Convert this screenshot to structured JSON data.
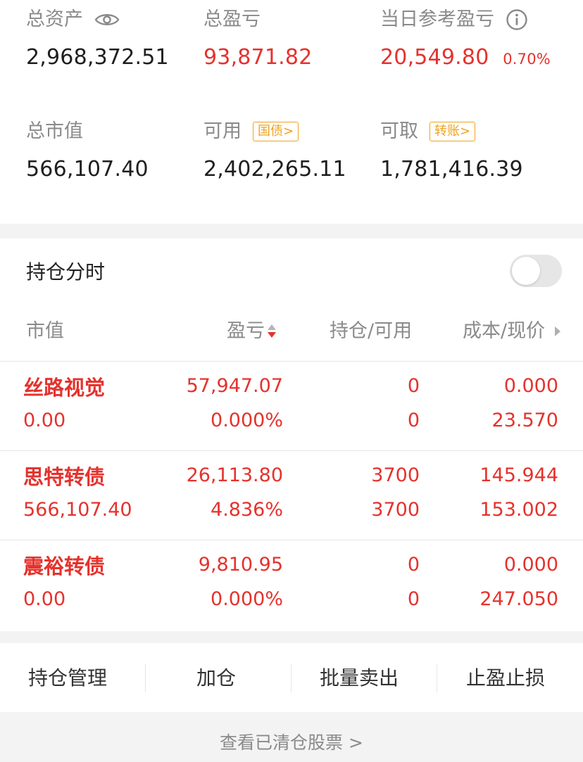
{
  "summary": {
    "total_assets": {
      "label": "总资产",
      "value": "2,968,372.51"
    },
    "total_pnl": {
      "label": "总盈亏",
      "value": "93,871.82"
    },
    "daily_pnl": {
      "label": "当日参考盈亏",
      "value": "20,549.80",
      "percent": "0.70%"
    },
    "market_value": {
      "label": "总市值",
      "value": "566,107.40"
    },
    "available": {
      "label": "可用",
      "value": "2,402,265.11",
      "tag": "国债>"
    },
    "withdrawable": {
      "label": "可取",
      "value": "1,781,416.39",
      "tag": "转账>"
    }
  },
  "holdings": {
    "title": "持仓分时",
    "toggle_on": false,
    "headers": {
      "market_value": "市值",
      "pnl": "盈亏",
      "position": "持仓/可用",
      "cost_price": "成本/现价"
    },
    "rows": [
      {
        "name": "丝路视觉",
        "market_value": "0.00",
        "pnl": "57,947.07",
        "pnl_pct": "0.000%",
        "position": "0",
        "available": "0",
        "cost": "0.000",
        "price": "23.570"
      },
      {
        "name": "思特转债",
        "market_value": "566,107.40",
        "pnl": "26,113.80",
        "pnl_pct": "4.836%",
        "position": "3700",
        "available": "3700",
        "cost": "145.944",
        "price": "153.002"
      },
      {
        "name": "震裕转债",
        "market_value": "0.00",
        "pnl": "9,810.95",
        "pnl_pct": "0.000%",
        "position": "0",
        "available": "0",
        "cost": "0.000",
        "price": "247.050"
      }
    ]
  },
  "actions": [
    "持仓管理",
    "加仓",
    "批量卖出",
    "止盈止损"
  ],
  "footer_link": "查看已清仓股票 >",
  "colors": {
    "up": "#e5322d",
    "tag": "#f0a21c",
    "muted": "#8a8a8a"
  }
}
